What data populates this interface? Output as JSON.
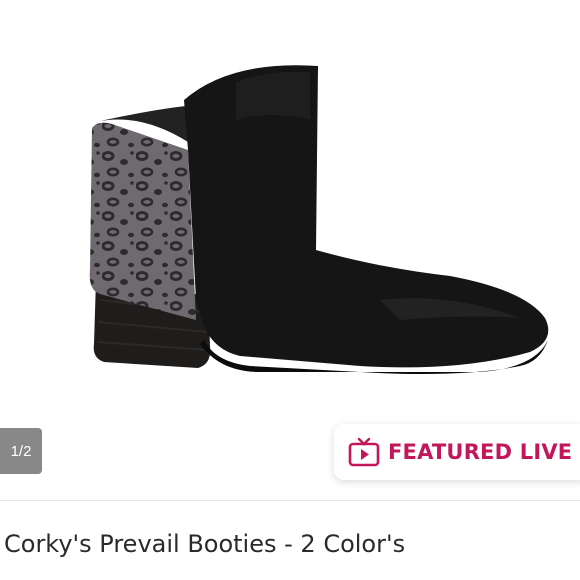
{
  "listing": {
    "image_counter": "1/2",
    "featured_label": "FEATURED LIVE",
    "title": "Corky's Prevail Booties - 2 Color's"
  },
  "icons": {
    "featured": "tv-play-icon"
  },
  "colors": {
    "featured_text": "#c2185b",
    "boot_body": "#151515",
    "leopard_base": "#6e6a70",
    "leopard_spot": "#2e2a30"
  }
}
